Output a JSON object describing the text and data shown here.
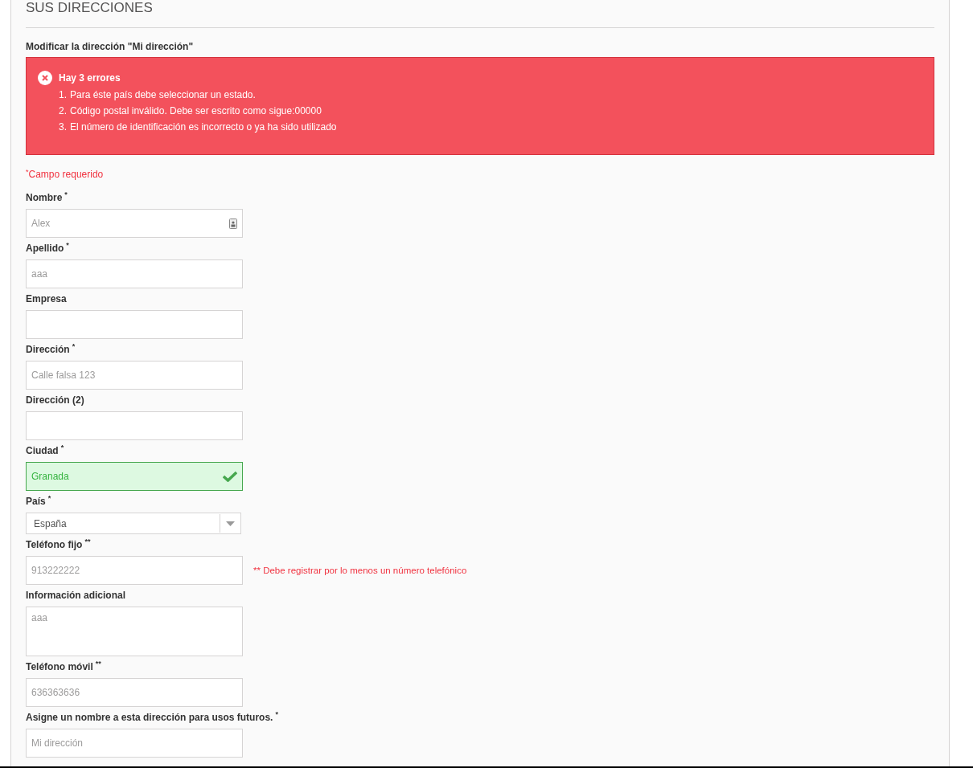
{
  "page_title": "SUS DIRECCIONES",
  "form_title": "Modificar la dirección \"Mi dirección\"",
  "error_box": {
    "title": "Hay 3 errores",
    "errors": [
      {
        "number": "1.",
        "text": "Para éste país debe seleccionar un estado."
      },
      {
        "number": "2.",
        "text": "Código postal inválido. Debe ser escrito como sigue:00000"
      },
      {
        "number": "3.",
        "text": "El número de identificación es incorrecto o ya ha sido utilizado"
      }
    ]
  },
  "required_note": {
    "mark": "*",
    "text": "Campo requerido"
  },
  "fields": [
    {
      "kind": "text",
      "label": "Nombre",
      "mark": "*",
      "value": "Alex",
      "valid": false,
      "contact_icon": true
    },
    {
      "kind": "text",
      "label": "Apellido",
      "mark": "*",
      "value": "aaa",
      "valid": false
    },
    {
      "kind": "text",
      "label": "Empresa",
      "valid": false
    },
    {
      "kind": "text",
      "label": "Dirección",
      "mark": "*",
      "value": "Calle falsa 123",
      "valid": false
    },
    {
      "kind": "text",
      "label": "Dirección (2)",
      "valid": false
    },
    {
      "kind": "text",
      "label": "Ciudad",
      "mark": "*",
      "value": "Granada",
      "valid": true
    },
    {
      "kind": "select",
      "label": "País",
      "mark": "*",
      "value": "España"
    },
    {
      "kind": "text",
      "label": "Teléfono fijo",
      "mark": "**",
      "value": "913222222",
      "valid": false,
      "note": "** Debe registrar por lo menos un número telefónico"
    },
    {
      "kind": "textarea",
      "label": "Información adicional",
      "value": "aaa"
    },
    {
      "kind": "text",
      "label": "Teléfono móvil",
      "mark": "**",
      "value": "636363636",
      "valid": false
    },
    {
      "kind": "text",
      "label": "Asigne un nombre a esta dirección para usos futuros.",
      "mark": "*",
      "value": "Mi dirección",
      "valid": false
    }
  ]
}
